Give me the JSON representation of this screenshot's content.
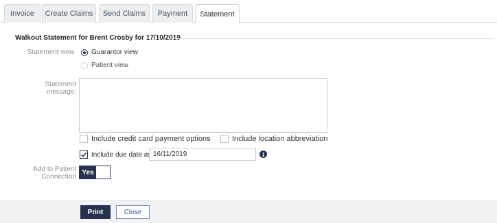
{
  "tabs": [
    {
      "label": "Invoice"
    },
    {
      "label": "Create Claims"
    },
    {
      "label": "Send Claims"
    },
    {
      "label": "Payment"
    },
    {
      "label": "Statement"
    }
  ],
  "active_tab": "Statement",
  "heading": "Walkout Statement for Brent Crosby for 17/10/2019",
  "statement_view": {
    "label": "Statement view:",
    "options": [
      {
        "label": "Guarantor view",
        "checked": true
      },
      {
        "label": "Patient view",
        "checked": false
      }
    ]
  },
  "statement_message": {
    "label": "Statement message:",
    "value": ""
  },
  "options": {
    "credit_card": {
      "label": "Include credit card payment options",
      "checked": false
    },
    "location_abbrev": {
      "label": "Include location abbreviation",
      "checked": false
    },
    "due_date": {
      "label": "Include due date as",
      "checked": true,
      "value": "16/11/2019"
    }
  },
  "patient_connection": {
    "label_line1": "Add to Patient",
    "label_line2": "Connection",
    "toggle_value": "Yes"
  },
  "footer": {
    "print_label": "Print",
    "close_label": "Close"
  },
  "colors": {
    "primary": "#26324e",
    "tab_bg": "#eceef0",
    "footer_bg": "#f1f2f4"
  }
}
